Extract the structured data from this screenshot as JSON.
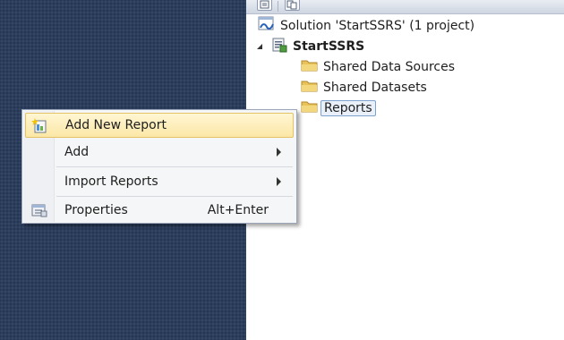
{
  "explorer": {
    "toolbar": {
      "buttons": [
        "properties-icon",
        "show-all-files-icon"
      ]
    },
    "tree": {
      "solution": {
        "label": "Solution 'StartSSRS' (1 project)",
        "icon": "solution-icon"
      },
      "project": {
        "label": "StartSSRS",
        "icon": "report-project-icon",
        "expanded": true
      },
      "folders": [
        {
          "label": "Shared Data Sources",
          "icon": "folder-icon"
        },
        {
          "label": "Shared Datasets",
          "icon": "folder-icon"
        },
        {
          "label": "Reports",
          "icon": "folder-icon",
          "selected": true
        }
      ]
    }
  },
  "context_menu": {
    "items": [
      {
        "label": "Add New Report",
        "icon": "add-new-report-icon",
        "highlighted": true,
        "shortcut": "",
        "submenu": false
      },
      {
        "label": "Add",
        "icon": "",
        "highlighted": false,
        "shortcut": "",
        "submenu": true
      },
      {
        "label": "Import Reports",
        "icon": "",
        "highlighted": false,
        "shortcut": "",
        "submenu": true
      },
      {
        "label": "Properties",
        "icon": "properties-icon",
        "highlighted": false,
        "shortcut": "Alt+Enter",
        "submenu": false
      }
    ]
  },
  "colors": {
    "workspace_bg": "#2c3e5e",
    "menu_highlight": "#fbe7a6",
    "folder": "#e9c25a"
  }
}
